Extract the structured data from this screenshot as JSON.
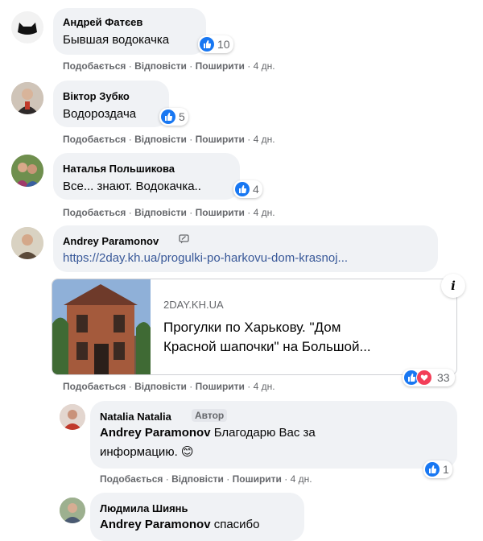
{
  "actions": {
    "like": "Подобається",
    "reply": "Відповісти",
    "share": "Поширити",
    "time": "4 дн.",
    "sep": "·"
  },
  "comments": [
    {
      "author": "Андрей Фатєев",
      "text": "Бывшая водокачка",
      "likes": "10",
      "avatar_icon": "cat-silhouette"
    },
    {
      "author": "Віктор Зубко",
      "text": "Водороздача",
      "likes": "5",
      "avatar_icon": "person-photo"
    },
    {
      "author": "Наталья Польшикова",
      "text": "Все... знают. Водокачка..",
      "likes": "4",
      "avatar_icon": "group-photo"
    },
    {
      "author": "Andrey Paramonov",
      "link": "https://2day.kh.ua/progulki-po-harkovu-dom-krasnoj...",
      "reactions": "33",
      "avatar_icon": "person-photo",
      "preview": {
        "domain": "2DAY.KH.UA",
        "title_line1": "Прогулки по Харькову. \"Дом",
        "title_line2": "Красной шапочки\" на Большой...",
        "info_icon": "info-icon"
      }
    }
  ],
  "replies": [
    {
      "author": "Natalia Natalia",
      "badge": "Автор",
      "mention": "Andrey Paramonov",
      "text_line1": " Благодарю Вас за",
      "text_line2": "информацию. 😊",
      "likes": "1"
    },
    {
      "author": "Людмила Шиянь",
      "mention": "Andrey Paramonov",
      "text": " спасибо"
    }
  ],
  "colors": {
    "bubble": "#f0f2f5",
    "like_blue": "#1877f2",
    "heart_red": "#f33e58",
    "link": "#385898",
    "muted": "#65676b"
  }
}
